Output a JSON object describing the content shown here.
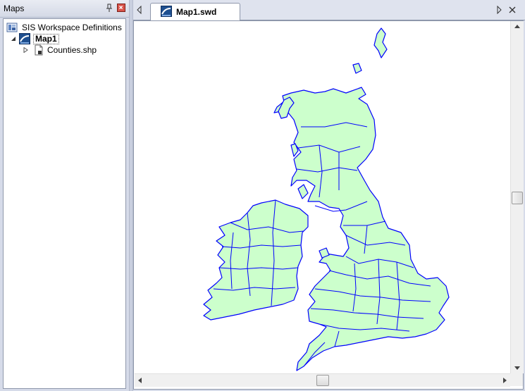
{
  "maps_pane": {
    "title": "Maps",
    "tree": {
      "root_label": "SIS Workspace Definitions",
      "map_label": "Map1",
      "layer_label": "Counties.shp"
    }
  },
  "document": {
    "tab_label": "Map1.swd"
  },
  "colors": {
    "land_fill": "#ccffcc",
    "county_border": "#0000ff",
    "panel_bg": "#d6dbe9"
  },
  "icons": [
    "pin-icon",
    "close-icon",
    "workspace-icon",
    "map-icon",
    "shapefile-icon",
    "expand-arrow-icon",
    "collapse-arrow-icon",
    "chevron-left-icon",
    "chevron-right-icon",
    "close-tab-icon"
  ]
}
